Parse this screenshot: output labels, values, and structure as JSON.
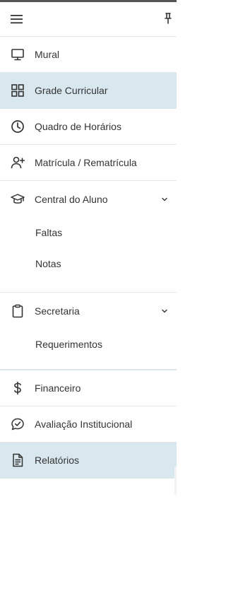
{
  "header": {
    "menu_icon": "hamburger-menu-icon",
    "pin_icon": "pin-icon"
  },
  "colors": {
    "active_bg": "#d9e7ee",
    "text": "#333333",
    "divider": "#e6e6e6"
  },
  "menu": {
    "items": [
      {
        "label": "Mural",
        "icon": "monitor-icon",
        "active": false
      },
      {
        "label": "Grade Curricular",
        "icon": "grid-icon",
        "active": true
      },
      {
        "label": "Quadro de Horários",
        "icon": "clock-icon",
        "active": false
      },
      {
        "label": "Matrícula / Rematrícula",
        "icon": "user-plus-icon",
        "active": false
      },
      {
        "label": "Central do Aluno",
        "icon": "graduation-cap-icon",
        "active": false,
        "expanded": true,
        "children": [
          "Faltas",
          "Notas"
        ]
      },
      {
        "label": "Secretaria",
        "icon": "clipboard-icon",
        "active": false,
        "expanded": true,
        "children": [
          "Requerimentos"
        ]
      },
      {
        "label": "Financeiro",
        "icon": "dollar-icon",
        "active": false
      },
      {
        "label": "Avaliação Institucional",
        "icon": "chat-check-icon",
        "active": false
      },
      {
        "label": "Relatórios",
        "icon": "document-icon",
        "active": true
      }
    ]
  }
}
